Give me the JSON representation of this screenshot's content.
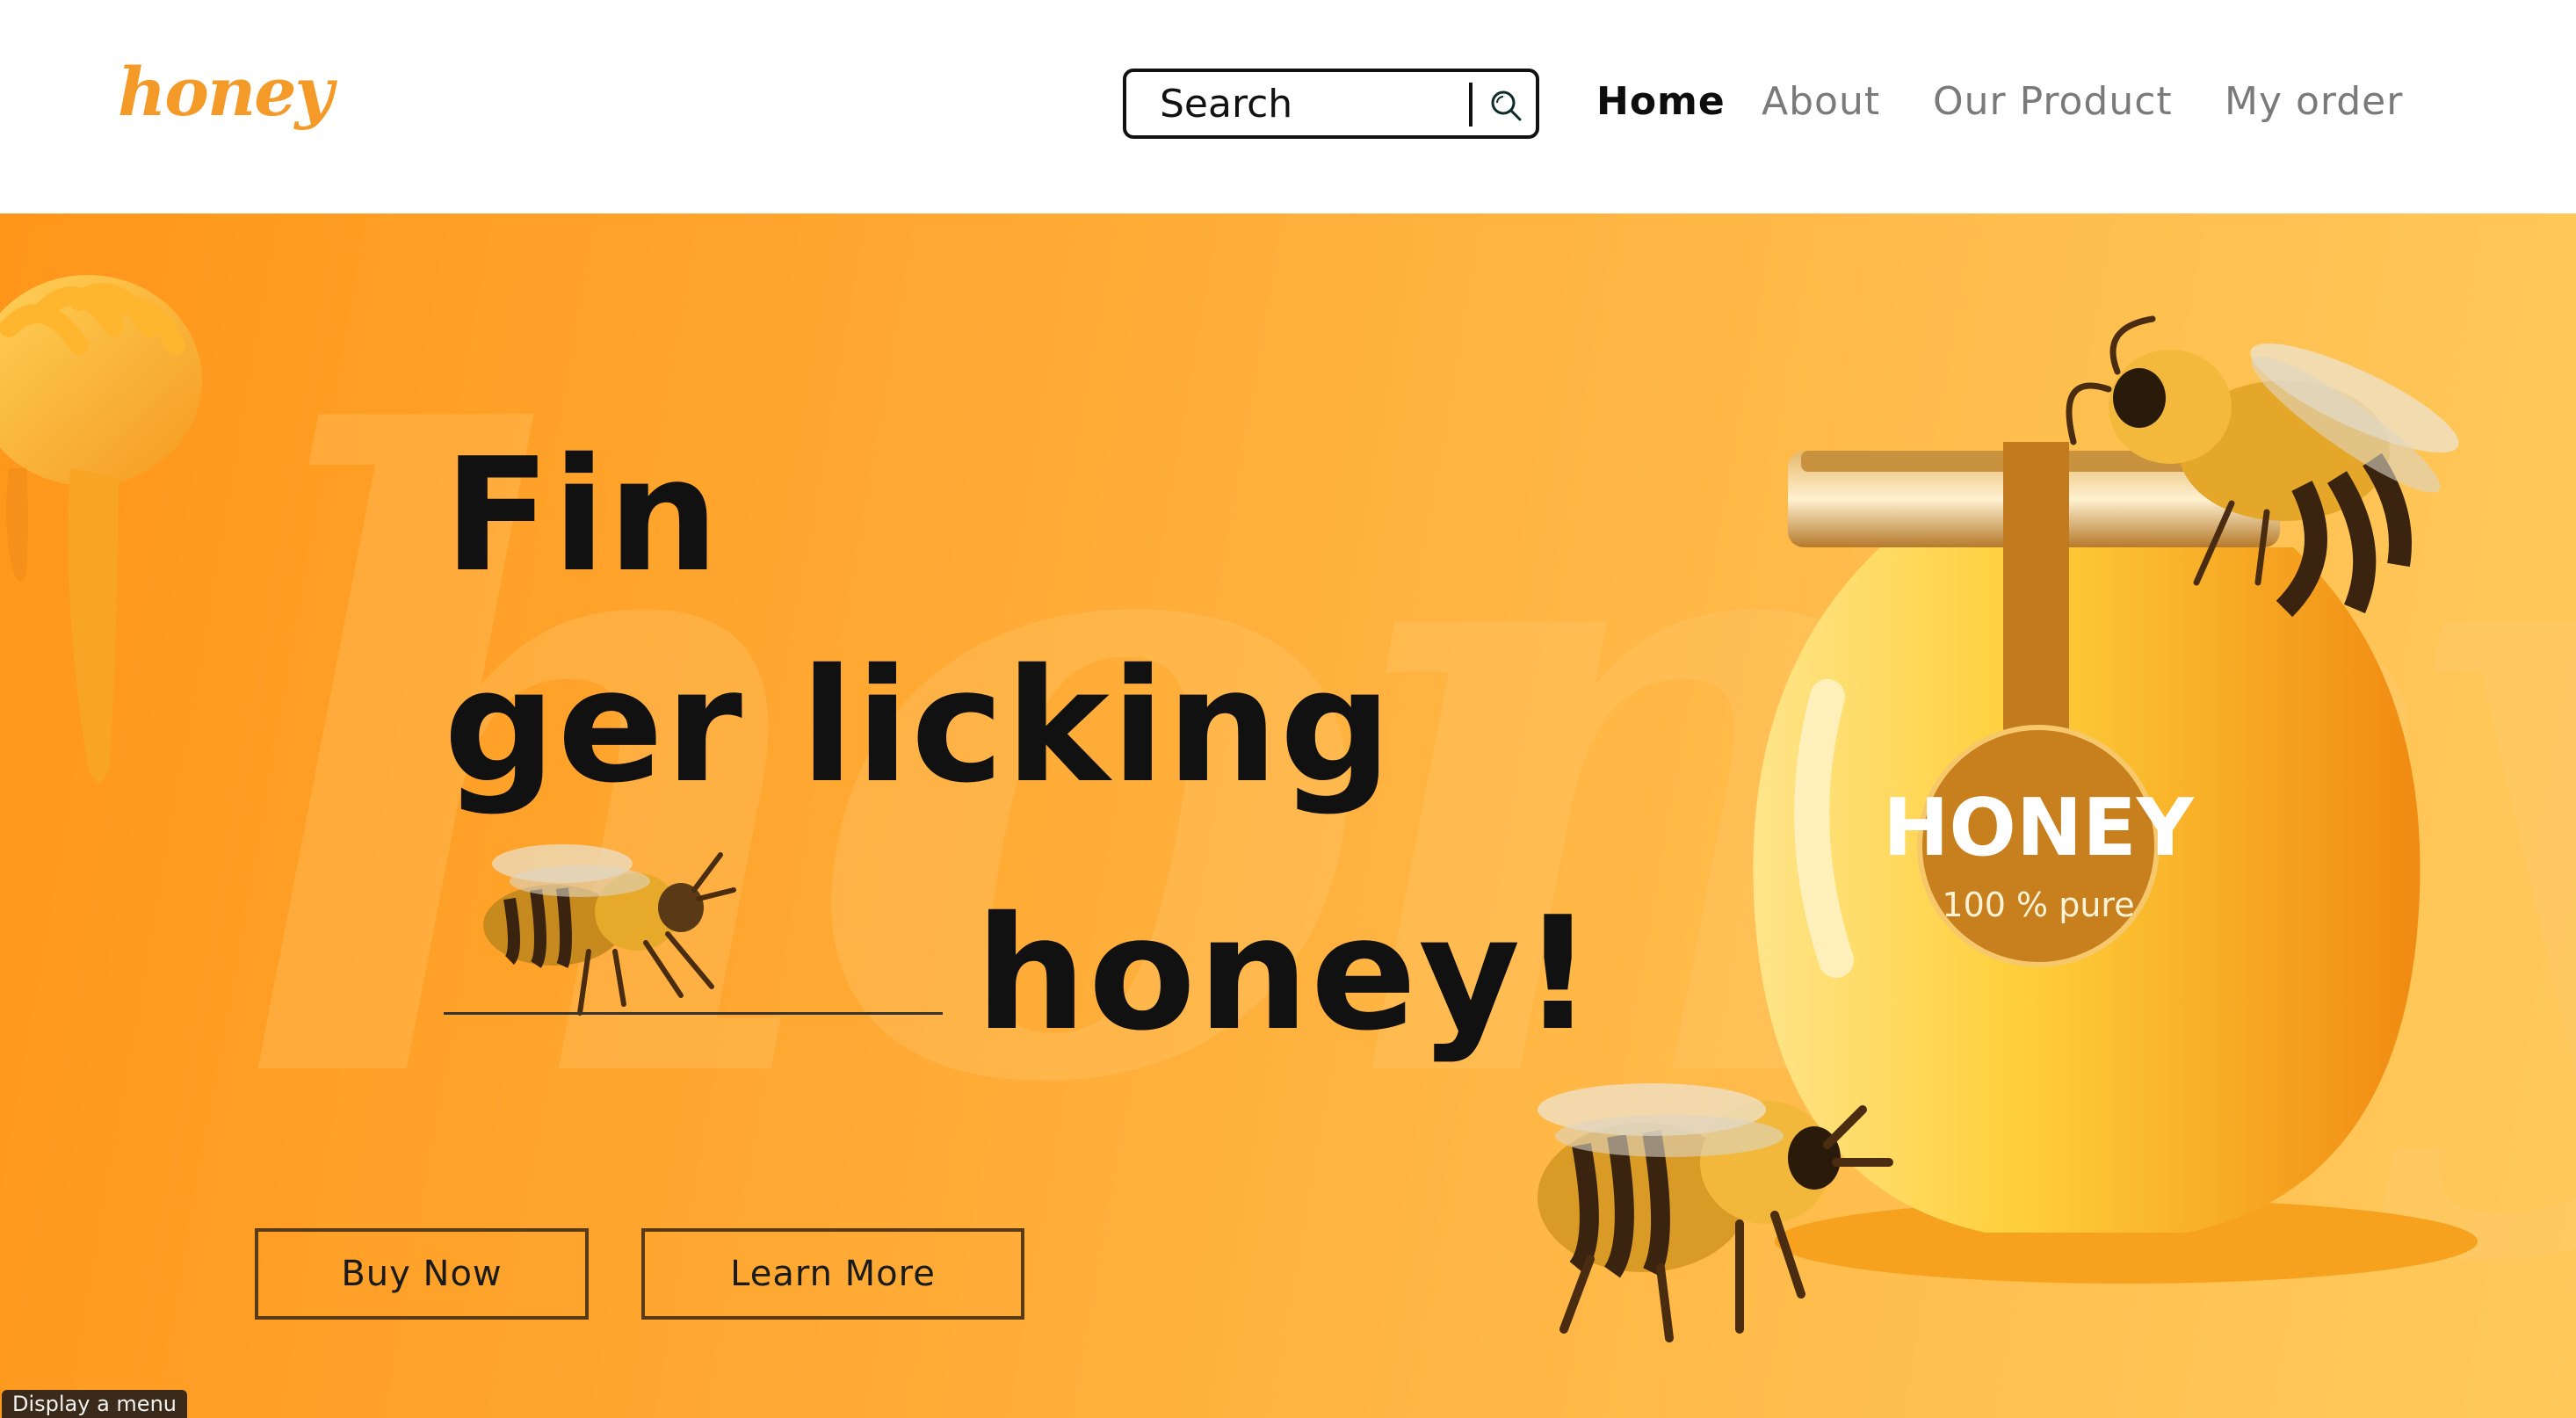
{
  "header": {
    "logo_text": "honey",
    "search": {
      "placeholder": "Search",
      "value": ""
    },
    "nav": [
      {
        "label": "Home",
        "active": true
      },
      {
        "label": "About",
        "active": false
      },
      {
        "label": "Our Product",
        "active": false
      },
      {
        "label": "My order",
        "active": false
      }
    ]
  },
  "hero": {
    "headline_line_1": "Fin",
    "headline_line_2": "ger licking",
    "headline_line_3": "honey!",
    "watermark_text": "honey",
    "buy_now_label": "Buy Now",
    "learn_more_label": "Learn More",
    "jar_label_title": "HONEY",
    "jar_label_subtitle": "100 % pure"
  },
  "tooltip": "Display a menu",
  "colors": {
    "brand_orange": "#f39a28",
    "hero_gradient_start": "#ff961a",
    "hero_gradient_end": "#ffc95c",
    "text_dark": "#111111",
    "nav_inactive": "#7a7a7a"
  },
  "icons": [
    "search-icon",
    "honey-dipper-icon",
    "honey-jar-icon",
    "bee-icon"
  ]
}
